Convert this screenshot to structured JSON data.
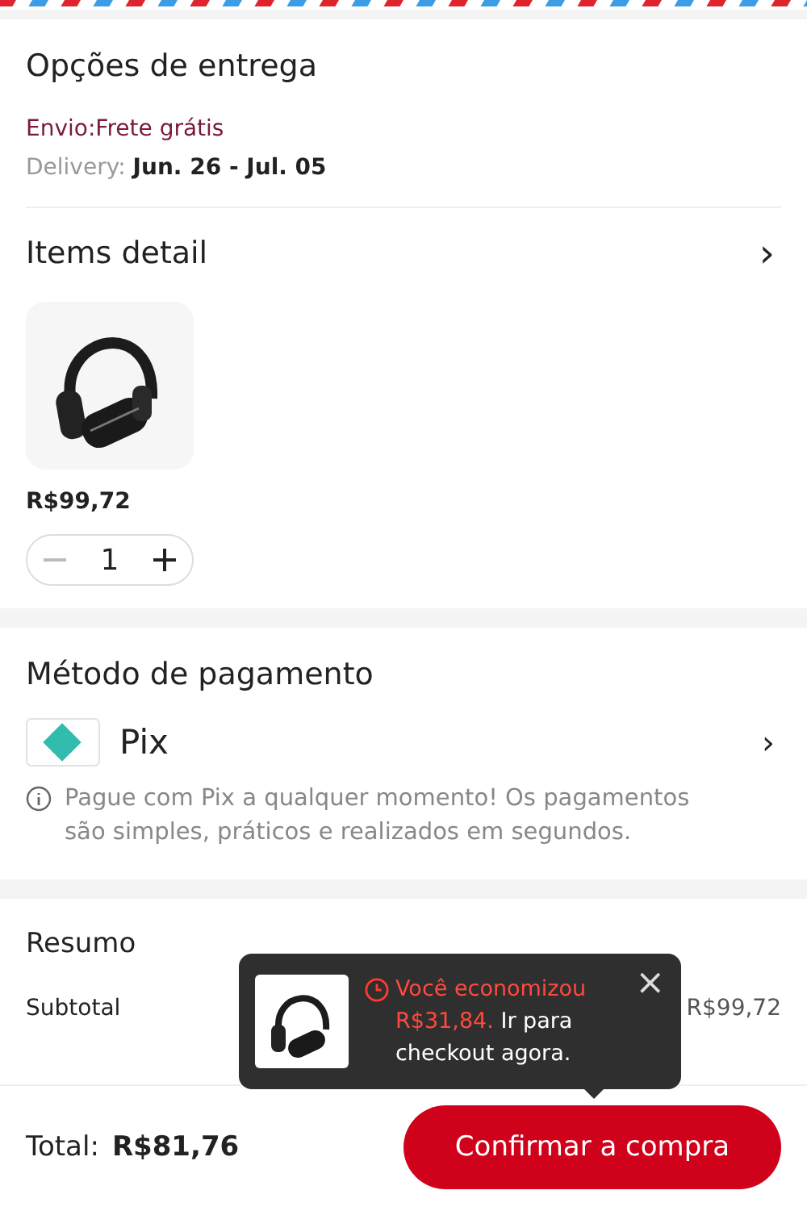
{
  "delivery": {
    "title": "Opções de entrega",
    "shipping": "Envio:Frete grátis",
    "delivery_label": "Delivery:",
    "delivery_dates": "Jun. 26 - Jul. 05"
  },
  "items_detail": {
    "title": "Items detail",
    "chevron": "›",
    "items": [
      {
        "kind": "picture",
        "price": "R$99,72",
        "quantity": "1"
      }
    ]
  },
  "payment": {
    "title": "Método de pagamento",
    "method": "Pix",
    "chevron": "›",
    "info": "Pague com Pix a qualquer momento! Os pagamentos são simples, práticos e realizados em segundos."
  },
  "summary": {
    "title": "Resumo",
    "rows": [
      {
        "label": "Subtotal",
        "value": "R$99,72"
      }
    ]
  },
  "tooltip": {
    "highlight": "Você economizou R$31,84.",
    "text": " Ir para checkout agora.",
    "close": "×"
  },
  "footer": {
    "total_label": "Total:",
    "total_value": "R$81,76",
    "button": "Confirmar a compra"
  }
}
